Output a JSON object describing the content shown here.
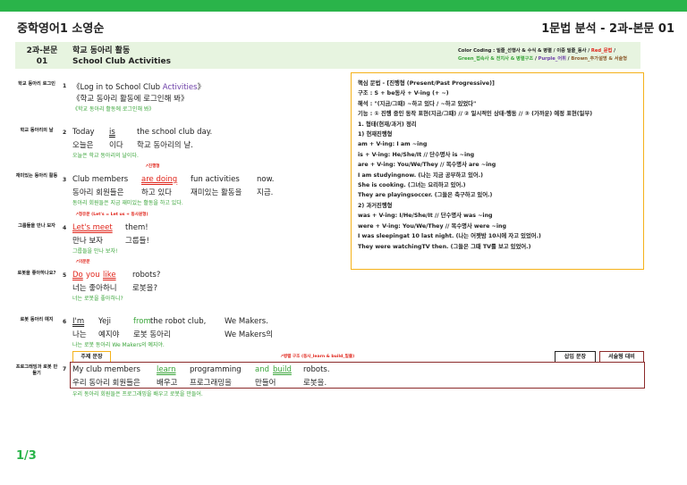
{
  "doc": {
    "title_left": "중학영어1 소영순",
    "title_right": "1문법 분석 - 2과-본문 01",
    "page": "1/3"
  },
  "header": {
    "lesson_num": "2과-본문\n01",
    "title_ko": "학교 동아리 활동",
    "title_en": "School Club Activities",
    "cc1": "Color Coding : 밑줄_선행사 & 수식 & 병렬 / 이중 밑줄_동사 / ",
    "cc_red": "Red_문법",
    "cc1b": " /",
    "cc_green": "Green_접속사 & 전치사 & 병렬구조",
    "cc_sep1": " / ",
    "cc_purple": "Purple_어휘",
    "cc_sep2": " / ",
    "cc_brown": "Brown_추가설명 & 서술형"
  },
  "rows": [
    {
      "label": "학교 동아리 로그인",
      "num": "1",
      "en_a": "《Log in to School Club ",
      "en_b": "Activities",
      "en_c": "》",
      "ko": "《학교 동아리 활동에 로그인해 봐》",
      "tr": "《학교 동아리 활동에 로그인해 봐》"
    },
    {
      "label": "학교 동아리의 날",
      "num": "2",
      "w": [
        "Today",
        "is",
        "the school club day."
      ],
      "k": [
        "오늘은",
        "이다",
        "학교 동아리의 날."
      ],
      "tr": "오늘은 학교 동아리의 날이다."
    },
    {
      "label": "재미있는 동아리 활동",
      "num": "3",
      "note": "진행형",
      "w": [
        "Club members",
        "are doing",
        "fun activities",
        "now."
      ],
      "k": [
        "동아리 회원들은",
        "하고 있다",
        "재미있는 활동을",
        "지금."
      ],
      "tr": "동아리 회원들은 지금 재미있는 활동을 하고 있다."
    },
    {
      "label": "그룹들을 만나 보자",
      "num": "4",
      "note": "청유문 (Let's = Let us + 동사원형)",
      "w": [
        "Let's meet",
        "them!"
      ],
      "k": [
        "만나 보자",
        "그룹들!"
      ],
      "tr": "그룹들을 만나 보자!"
    },
    {
      "label": "로봇을 좋아하나요?",
      "num": "5",
      "note": "의문문",
      "w": [
        "Do",
        "you",
        "like",
        "robots?"
      ],
      "k": [
        "너는 좋아하니",
        "로봇을?"
      ],
      "tr": "너는 로봇을 좋아하니?"
    },
    {
      "label": "로봇 동아리 예지",
      "num": "6",
      "w": [
        "I'm",
        "Yeji",
        "from",
        " the robot club,",
        "We Makers."
      ],
      "k": [
        "나는",
        "예지야",
        "로봇 동아리",
        "We Makers의"
      ],
      "tr": "나는 로봇 동아리 We Makers의 예지야."
    },
    {
      "label": "프로그래밍과 로봇 만들기",
      "num": "7",
      "note": "병렬 구조 (동사_learn & build_밑줄)",
      "w": [
        "My club members",
        "learn",
        "programming",
        "and",
        "build",
        "robots."
      ],
      "k": [
        "우리 동아리 회원들은",
        "배우고",
        "프로그래밍을",
        "만들어",
        "로봇을."
      ],
      "tr": "우리 동아리 회원들은 프로그래밍을 배우고 로봇을 만들어."
    }
  ],
  "tags": {
    "main": "주제 문장",
    "insert": "삽입 문장",
    "essay": "서술형 대비"
  },
  "grammar": [
    "핵심 문법 - [진행형 (Present/Past Progressive)]",
    "구조 : S + be동사 + V-ing (+ ~)",
    "해석 : \"(지금/그때) ~하고 있다 / ~하고 있었다\"",
    "기능 : ① 진행 중인 동작 표현(지금/그때) // ② 일시적인 상태·행동 // ③ (가까운) 예정 표현(일부)",
    "1. 형태(현재/과거) 정리",
    "1) 현재진행형",
    "am + V-ing: I am ~ing",
    "is + V-ing: He/She/It // 단수명사 is ~ing",
    "are + V-ing: You/We/They // 복수명사 are ~ing",
    "I am studyingnow. (나는 지금 공부하고 있어.)",
    "She is cooking. (그녀는 요리하고 있어.)",
    "They are playingsoccer. (그들은 축구하고 있어.)",
    "2) 과거진행형",
    "was + V-ing: I/He/She/It // 단수명사 was ~ing",
    "were + V-ing: You/We/They // 복수명사 were ~ing",
    "I was sleepingat 10 last night. (나는 어젯밤 10시에 자고 있었어.)",
    "They were watchingTV then. (그들은 그때 TV를 보고 있었어.)"
  ],
  "colors": {
    "green": "#2ab44a",
    "red": "#e0251b",
    "orange": "#f5b21a",
    "maroon": "#8b2a2a"
  }
}
